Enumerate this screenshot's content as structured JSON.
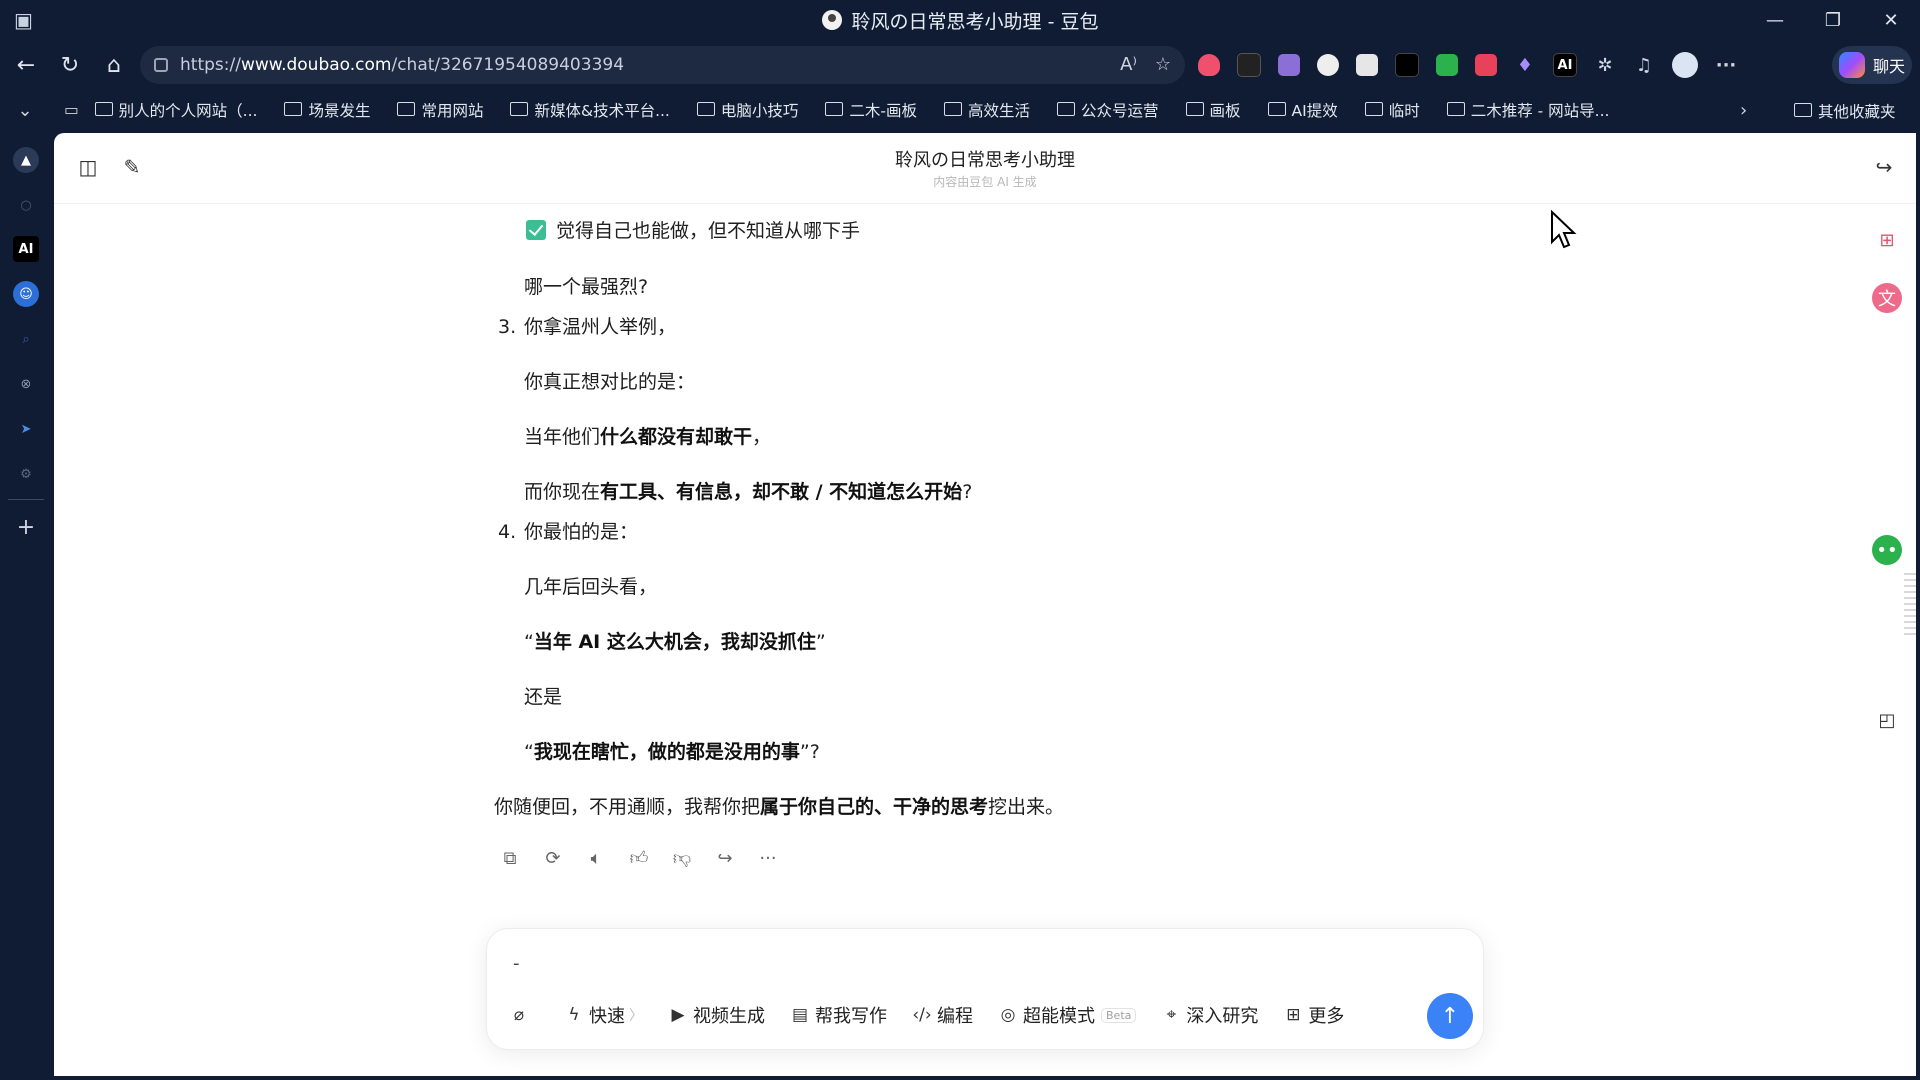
{
  "window": {
    "title": "聆风の日常思考小助理 - 豆包",
    "controls": [
      "minimize",
      "restore",
      "close"
    ]
  },
  "address_bar": {
    "url_prefix": "https://",
    "url_host": "www.doubao.com",
    "url_path": "/chat/32671954089403394"
  },
  "toolbar": {
    "chat_label": "聊天"
  },
  "bookmarks": {
    "items": [
      "别人的个人网站（...",
      "场景发生",
      "常用网站",
      "新媒体&技术平台...",
      "电脑小技巧",
      "二木-画板",
      "高效生活",
      "公众号运营",
      "画板",
      "AI提效",
      "临时",
      "二木推荐 - 网站导..."
    ],
    "other": "其他收藏夹"
  },
  "chat": {
    "title": "聆风の日常思考小助理",
    "subtitle": "内容由豆包 AI 生成"
  },
  "message": {
    "checked_line": "觉得自己也能做，但不知道从哪下手",
    "q_strongest": "哪一个最强烈?",
    "item3_num": "3.",
    "item3_text": "你拿温州人举例，",
    "item3_l1": "你真正想对比的是：",
    "item3_l2_pre": "当年他们",
    "item3_l2_bold": "什么都没有却敢干",
    "item3_l2_post": "，",
    "item3_l3_pre": "而你现在",
    "item3_l3_bold": "有工具、有信息，却不敢 / 不知道怎么开始",
    "item3_l3_post": "?",
    "item4_num": "4.",
    "item4_text": "你最怕的是：",
    "item4_l1": "几年后回头看，",
    "item4_l2_open": "“",
    "item4_l2_bold": "当年 AI 这么大机会，我却没抓住",
    "item4_l2_close": "”",
    "item4_l3": "还是",
    "item4_l4_open": "“",
    "item4_l4_bold": "我现在瞎忙，做的都是没用的事",
    "item4_l4_close": "”?",
    "closing_pre": "你随便回，不用通顺，我帮你把",
    "closing_bold": "属于你自己的、干净的思考",
    "closing_post": "挖出来。"
  },
  "composer": {
    "input_value": "-",
    "tools": {
      "quick": "快速",
      "video": "视频生成",
      "write": "帮我写作",
      "code": "编程",
      "super": "超能模式",
      "beta": "Beta",
      "research": "深入研究",
      "more": "更多"
    }
  },
  "colors": {
    "accent": "#3b82f6",
    "check": "#3bbf92",
    "chrome": "#0f1c33"
  }
}
